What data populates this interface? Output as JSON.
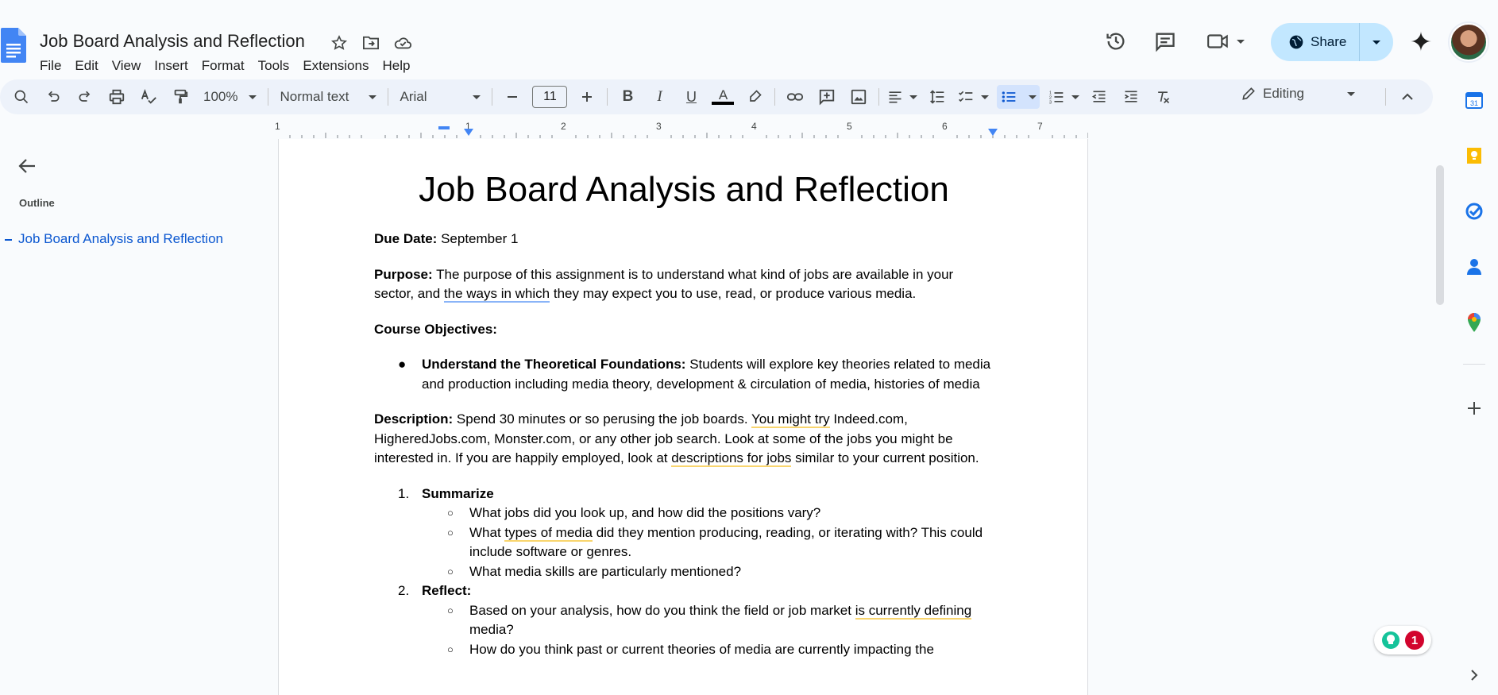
{
  "app": {
    "document_title": "Job Board Analysis and Reflection",
    "menu": [
      "File",
      "Edit",
      "View",
      "Insert",
      "Format",
      "Tools",
      "Extensions",
      "Help"
    ],
    "share_label": "Share"
  },
  "toolbar": {
    "zoom": "100%",
    "style": "Normal text",
    "font": "Arial",
    "font_size": "11",
    "mode": "Editing"
  },
  "outline": {
    "title": "Outline",
    "entries": [
      "Job Board Analysis and Reflection"
    ]
  },
  "ruler": [
    "1",
    "1",
    "2",
    "3",
    "4",
    "5",
    "6",
    "7"
  ],
  "document": {
    "heading": "Job Board Analysis and Reflection",
    "due_label": "Due Date:",
    "due_value": " September 1",
    "purpose_label": "Purpose:",
    "purpose_text_1": " The purpose of this assignment is to understand what kind of jobs are available in your sector, and ",
    "purpose_underlined": "the ways in which",
    "purpose_text_2": " they may expect you to use, read, or produce various media.",
    "objectives_label": "Course Objectives:",
    "objective_1_label": "Understand the Theoretical Foundations:",
    "objective_1_text": " Students will explore key theories related to media and production including media theory, development & circulation of media, histories of media",
    "description_label": "Description:",
    "description_1": " Spend 30 minutes or so perusing the job boards. ",
    "description_ul_1": "You might try",
    "description_2": " Indeed.com, HigheredJobs.com, Monster.com, or any other job search. Look at some of the jobs you might be interested in. If you are happily employed, look at ",
    "description_ul_2": "descriptions for jobs",
    "description_3": " similar to your current position.",
    "list": [
      {
        "num": "1.",
        "title": "Summarize",
        "items": [
          {
            "pre": "What jobs did you look up, and how did the positions vary?",
            "ul": "",
            "post": ""
          },
          {
            "pre": "What ",
            "ul": "types of media",
            "post": " did they mention producing, reading, or iterating with? This could include software or genres."
          },
          {
            "pre": "What media skills are particularly mentioned?",
            "ul": "",
            "post": ""
          }
        ]
      },
      {
        "num": "2.",
        "title": "Reflect:",
        "items": [
          {
            "pre": "Based on your analysis, how do you think the field or job market ",
            "ul": "is currently defining",
            "post": " media?"
          },
          {
            "pre": "How do you think past or current theories of media are currently impacting the",
            "ul": "",
            "post": ""
          }
        ]
      }
    ]
  },
  "grammarly": {
    "count": "1"
  },
  "colors": {
    "accent": "#0b57d0",
    "share_bg": "#c2e7ff",
    "toolbar_bg": "#edf2fa",
    "page_bg": "#ffffff",
    "canvas_bg": "#f9fbfd"
  }
}
